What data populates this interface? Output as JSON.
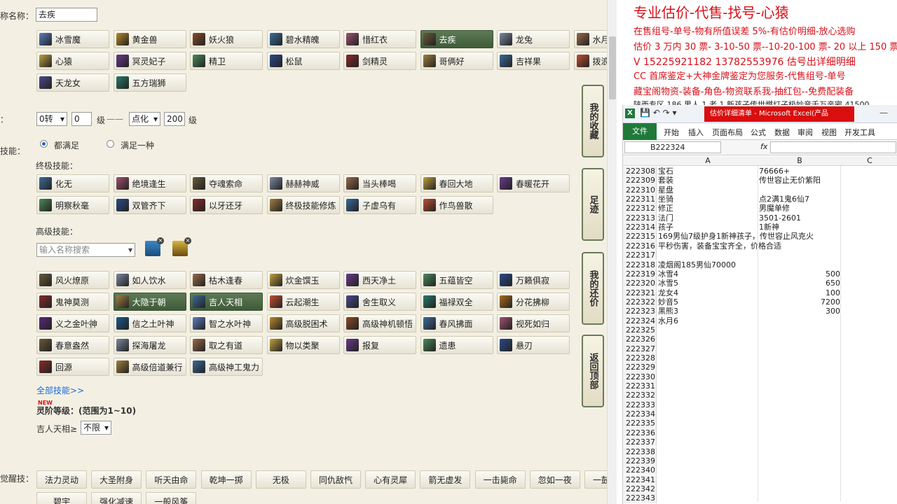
{
  "left": {
    "name_label": "称名称：",
    "name_value": "去疾",
    "pets": [
      "冰雪魔",
      "黄金兽",
      "妖火狼",
      "碧水精魄",
      "惜红衣",
      "去疾",
      "龙兔",
      "水月",
      "心猿",
      "冥灵妃子",
      "精卫",
      "松鼠",
      "剑精灵",
      "哥俩好",
      "吉祥果",
      "拨浪",
      "天龙女",
      "五方瑞狮"
    ],
    "level_label": "：",
    "rebirth_value": "0转",
    "min_level": "0",
    "level_unit": "级",
    "dash": "——",
    "mode_value": "点化",
    "max_level": "200",
    "level_unit2": "级",
    "skill_label": "技能：",
    "radio_all": "都满足",
    "radio_one": "满足一种",
    "ultimate_label": "终极技能：",
    "ultimate": [
      "化无",
      "绝境逢生",
      "夺魂索命",
      "赫赫神威",
      "当头棒喝",
      "春回大地",
      "春暖花开",
      "明察秋毫",
      "双管齐下",
      "以牙还牙",
      "终极技能修炼",
      "子虚乌有",
      "作鸟兽散"
    ],
    "advanced_label": "高级技能：",
    "search_placeholder": "输入名称搜索",
    "advanced": [
      "风火燎原",
      "如人饮水",
      "枯木逢春",
      "炊金馔玉",
      "西天净土",
      "五蕴皆空",
      "万籁俱寂",
      "鬼神莫测",
      "大隐于朝",
      "吉人天相",
      "云起潮生",
      "舍生取义",
      "福禄双全",
      "分花拂柳",
      "义之金叶神",
      "信之土叶神",
      "智之水叶神",
      "高级脱困术",
      "高级神机顿悟",
      "春风拂面",
      "视死如归",
      "春意盎然",
      "探海屠龙",
      "取之有道",
      "物以类聚",
      "报复",
      "遗患",
      "悬刃",
      "回源",
      "高级倍道兼行",
      "高级神工鬼力"
    ],
    "all_skills_link": "全部技能>>",
    "new_badge": "NEW",
    "spirit_label": "灵阶等级：(范围为1~10)",
    "jiren_label": "吉人天相≥",
    "jiren_value": "不限",
    "awaken_label": "觉醒技：",
    "awaken": [
      "法力灵动",
      "大圣附身",
      "听天由命",
      "乾坤一掷",
      "无极",
      "同仇敌忾",
      "心有灵犀",
      "箭无虚发",
      "一击毙命",
      "忽如一夜",
      "一鼓作气"
    ],
    "awaken2": [
      "碧宇",
      "强化减速",
      "一般风筝"
    ],
    "side": [
      "我的收藏",
      "足迹",
      "我的还价",
      "返回顶部"
    ]
  },
  "right": {
    "red_title": "专业估价-代售-找号-心猿",
    "lines": [
      "在售组号-单号-物有所值误差 5%-有估价明细-放心选购",
      "估价 3 万内 30 票- 3-10-50 票--10-20-100 票- 20 以上 150 票-1 票 1 元",
      "V 15225921182    13782553976   估号出详细明细",
      "CC 首席鉴定+大神金牌鉴定为您服务-代售组号-单号",
      "藏宝阁物资-装备-角色-物资联系我-抽红包--免费配装备",
      "陕西专区 186 男人 1 老 1 新孩子传世燃灯子极妙音千万亲密 41500"
    ],
    "excel": {
      "title": "估价详细清单 - Microsoft Excel(产品",
      "tabs": [
        "文件",
        "开始",
        "插入",
        "页面布局",
        "公式",
        "数据",
        "审阅",
        "视图",
        "开发工具"
      ],
      "cell_ref": "B222324",
      "fx": "fx",
      "cols": [
        "A",
        "B",
        "C"
      ],
      "rows": [
        {
          "n": "222308",
          "a": "宝石",
          "b": "76666+"
        },
        {
          "n": "222309",
          "a": "套装",
          "b": "传世容止无价紫阳"
        },
        {
          "n": "222310",
          "a": "星盘",
          "b": ""
        },
        {
          "n": "222311",
          "a": "坐骑",
          "b": "点2满1鬼6仙7"
        },
        {
          "n": "222312",
          "a": "修正",
          "b": "男魔单修"
        },
        {
          "n": "222313",
          "a": "法门",
          "b": "3501-2601"
        },
        {
          "n": "222314",
          "a": "孩子",
          "b": "1新神"
        },
        {
          "n": "222315",
          "a": "169男仙7级护身1新神孩子，传世容止风克火",
          "b": ""
        },
        {
          "n": "222316",
          "a": "平秒伤害，装备宝宝齐全，价格合适",
          "b": ""
        },
        {
          "n": "222317",
          "a": "",
          "b": ""
        },
        {
          "n": "222318",
          "a": "凌烟阁185男仙70000",
          "b": ""
        },
        {
          "n": "222319",
          "a": "冰雪4",
          "b": "500",
          "num": true
        },
        {
          "n": "222320",
          "a": "冰雪5",
          "b": "650",
          "num": true
        },
        {
          "n": "222321",
          "a": "龙女4",
          "b": "100",
          "num": true
        },
        {
          "n": "222322",
          "a": "妙音5",
          "b": "7200",
          "num": true
        },
        {
          "n": "222323",
          "a": "黑熊3",
          "b": "300",
          "num": true
        },
        {
          "n": "222324",
          "a": "水月6",
          "b": ""
        },
        {
          "n": "222325",
          "a": "",
          "b": ""
        },
        {
          "n": "222326",
          "a": "",
          "b": ""
        },
        {
          "n": "222327",
          "a": "",
          "b": ""
        },
        {
          "n": "222328",
          "a": "",
          "b": ""
        },
        {
          "n": "222329",
          "a": "",
          "b": ""
        },
        {
          "n": "222330",
          "a": "",
          "b": ""
        },
        {
          "n": "222331",
          "a": "",
          "b": ""
        },
        {
          "n": "222332",
          "a": "",
          "b": ""
        },
        {
          "n": "222333",
          "a": "",
          "b": ""
        },
        {
          "n": "222334",
          "a": "",
          "b": ""
        },
        {
          "n": "222335",
          "a": "",
          "b": ""
        },
        {
          "n": "222336",
          "a": "",
          "b": ""
        },
        {
          "n": "222337",
          "a": "",
          "b": ""
        },
        {
          "n": "222338",
          "a": "",
          "b": ""
        },
        {
          "n": "222339",
          "a": "",
          "b": ""
        },
        {
          "n": "222340",
          "a": "",
          "b": ""
        },
        {
          "n": "222341",
          "a": "",
          "b": ""
        },
        {
          "n": "222342",
          "a": "",
          "b": ""
        },
        {
          "n": "222343",
          "a": "",
          "b": ""
        }
      ]
    }
  }
}
